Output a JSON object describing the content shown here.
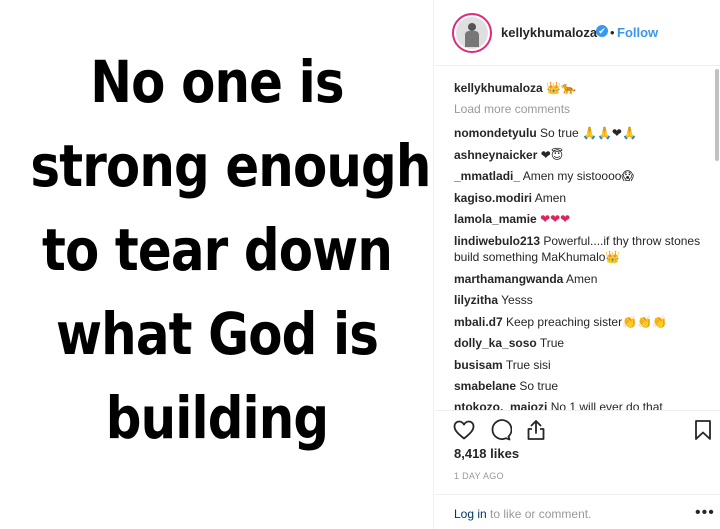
{
  "post": {
    "quote_lines": [
      "No one is",
      "strong enough",
      "to tear down",
      "what God is",
      "building"
    ]
  },
  "header": {
    "username": "kellykhumaloza",
    "verified_mark": "✔",
    "separator": "•",
    "follow_label": "Follow"
  },
  "caption": {
    "user": "kellykhumaloza",
    "text": "👑🐆"
  },
  "load_more_label": "Load more comments",
  "comments": [
    {
      "user": "nomondetyulu",
      "text": "So true 🙏🙏❤🙏"
    },
    {
      "user": "ashneynaicker",
      "text": "❤😇"
    },
    {
      "user": "_mmatladi_",
      "text": "Amen my sistoooo😱"
    },
    {
      "user": "kagiso.modiri",
      "text": "Amen"
    },
    {
      "user": "lamola_mamie",
      "text": "❤❤❤"
    },
    {
      "user": "lindiwebulo213",
      "text": "Powerful....if thy throw stones build something MaKhumalo👑"
    },
    {
      "user": "marthamangwanda",
      "text": "Amen"
    },
    {
      "user": "lilyzitha",
      "text": "Yesss"
    },
    {
      "user": "mbali.d7",
      "text": "Keep preaching sister👏👏👏"
    },
    {
      "user": "dolly_ka_soso",
      "text": "True"
    },
    {
      "user": "busisam",
      "text": "True sisi"
    },
    {
      "user": "smabelane",
      "text": "So true"
    },
    {
      "user": "ntokozo._majozi",
      "text": "No 1 will ever do that"
    }
  ],
  "actions": {
    "icons": [
      "heart-icon",
      "comment-icon",
      "share-icon",
      "bookmark-icon"
    ]
  },
  "likes_label": "8,418 likes",
  "timestamp": "1 DAY AGO",
  "footer": {
    "login_label": "Log in",
    "rest_label": " to like or comment.",
    "more_label": "•••"
  },
  "colors": {
    "accent": "#3897f0",
    "muted": "#999999",
    "text": "#262626",
    "ring": "#dd2a7b"
  }
}
